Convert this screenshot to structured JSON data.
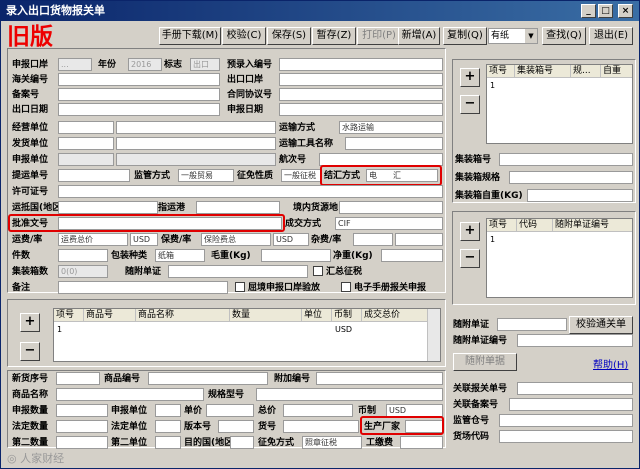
{
  "window": {
    "title": "录入出口货物报关单",
    "old_version_label": "旧版",
    "title_buttons": [
      "_",
      "□",
      "×"
    ]
  },
  "toolbar": {
    "manual_download": "手册下载(M)",
    "verify": "校验(C)",
    "save": "保存(S)",
    "temp_save": "暂存(Z)",
    "print": "打印(P)",
    "add": "新增(A)",
    "copy": "复制(Q)",
    "copy_option": "有纸",
    "find": "查找(Q)",
    "exit": "退出(E)"
  },
  "form": {
    "port_label": "申报口岸",
    "port_value": "...",
    "year_label": "年份",
    "year_value": "2016",
    "flag_label": "标志",
    "flag_value": "出口",
    "preentry_label": "预录入编号",
    "customs_no_label": "海关编号",
    "export_port_label": "出口口岸",
    "record_no_label": "备案号",
    "contract_label": "合同协议号",
    "export_date_label": "出口日期",
    "declare_date_label": "申报日期",
    "operator_label": "经营单位",
    "transport_mode_label": "运输方式",
    "transport_mode_value": "水路运输",
    "consignor_label": "发货单位",
    "vessel_label": "运输工具名称",
    "declarant_label": "申报单位",
    "bill_label": "航次号",
    "waybill_label": "提运单号",
    "supervision_label": "监管方式",
    "supervision_value": "一般贸易",
    "exemption_label": "征免性质",
    "exemption_value": "一般征税",
    "settlement_label": "结汇方式",
    "settlement_value": "电　　汇",
    "license_label": "许可证号",
    "dest_country_label": "运抵国(地区)",
    "dest_port_label": "指运港",
    "source_label": "境内货源地",
    "approval_label": "批准文号",
    "trade_terms_label": "成交方式",
    "trade_terms_value": "CIF",
    "freight_label": "运费/率",
    "freight_type": "运费总价",
    "freight_curr": "USD",
    "insurance_label": "保费/率",
    "insurance_type": "保险费总",
    "insurance_curr": "USD",
    "misc_label": "杂费/率",
    "pieces_label": "件数",
    "package_label": "包装种类",
    "package_value": "纸箱",
    "gross_label": "毛重(Kg)",
    "net_label": "净重(Kg)",
    "container_count_label": "集装箱数",
    "container_count_value": "0(0)",
    "attached_docs_label": "随附单证",
    "customs_tax_label": "汇总征税",
    "notes_label": "备注",
    "border_declare_label": "屈境申报口岸验放",
    "e_manual_label": "电子手册报关申报"
  },
  "container_grid": {
    "columns": [
      "项号",
      "集装箱号",
      "规...",
      "自重"
    ],
    "rows": [
      {
        "no": "1"
      }
    ]
  },
  "container_fields": {
    "no_label": "集装箱号",
    "spec_label": "集装箱规格",
    "weight_label": "集装箱自重(KG)"
  },
  "doc_grid": {
    "columns": [
      "项号",
      "代码",
      "随附单证编号"
    ],
    "rows": [
      {
        "no": "1"
      }
    ]
  },
  "goods_grid": {
    "columns": [
      "项号",
      "商品号",
      "商品名称",
      "数量",
      "单位",
      "币制",
      "成交总价"
    ],
    "rows": [
      {
        "no": "1",
        "currency": "USD"
      }
    ]
  },
  "goods_form": {
    "new_item_label": "新货序号",
    "goods_no_label": "商品编号",
    "extra_no_label": "附加编号",
    "goods_name_label": "商品名称",
    "spec_label": "规格型号",
    "declare_qty_label": "申报数量",
    "declare_unit_label": "申报单位",
    "unit_price_label": "单价",
    "total_price_label": "总价",
    "currency_label": "币制",
    "currency_value": "USD",
    "legal_qty_label": "法定数量",
    "legal_unit_label": "法定单位",
    "version_label": "版本号",
    "item_no_label": "货号",
    "manufacturer_label": "生产厂家",
    "second_qty_label": "第二数量",
    "second_unit_label": "第二单位",
    "dest_label": "目的国(地区)",
    "exempt_label": "征免方式",
    "exempt_value": "照章征税",
    "tax_label": "工缴费"
  },
  "side_form": {
    "attached_doc_label": "随附单证",
    "verify_pass_btn": "校验通关单",
    "attached_doc_no_label": "随附单证编号",
    "attach_btn": "随附单据",
    "help_link": "帮助(H)",
    "related_declare_label": "关联报关单号",
    "related_record_label": "关联备案号",
    "bonded_label": "监管仓号",
    "cargo_code_label": "货场代码"
  },
  "watermark": "人家财经"
}
